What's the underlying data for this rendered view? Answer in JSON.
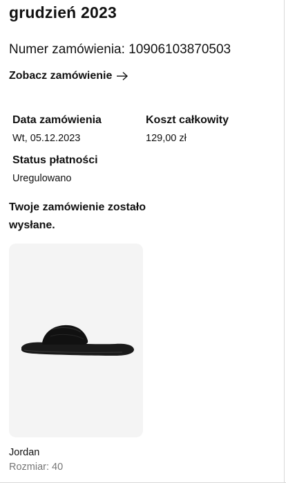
{
  "header": {
    "month": "grudzień 2023",
    "order_number": "Numer zamówienia: 10906103870503",
    "view_order_label": "Zobacz zamówienie",
    "view_order_icon": "arrow-right-icon"
  },
  "details": {
    "order_date": {
      "label": "Data zamówienia",
      "value": "Wt, 05.12.2023"
    },
    "total_cost": {
      "label": "Koszt całkowity",
      "value": "129,00 zł"
    },
    "payment_status": {
      "label": "Status płatności",
      "value": "Uregulowano"
    }
  },
  "shipment": {
    "status_text": "Twoje zamówienie zostało wysłane."
  },
  "product": {
    "brand": "Jordan",
    "size": "Rozmiar: 40",
    "image_icon": "slide-sandal-image",
    "card_background": "#f4f4f4"
  },
  "colors": {
    "text": "#111111",
    "secondary_text": "#767676"
  }
}
